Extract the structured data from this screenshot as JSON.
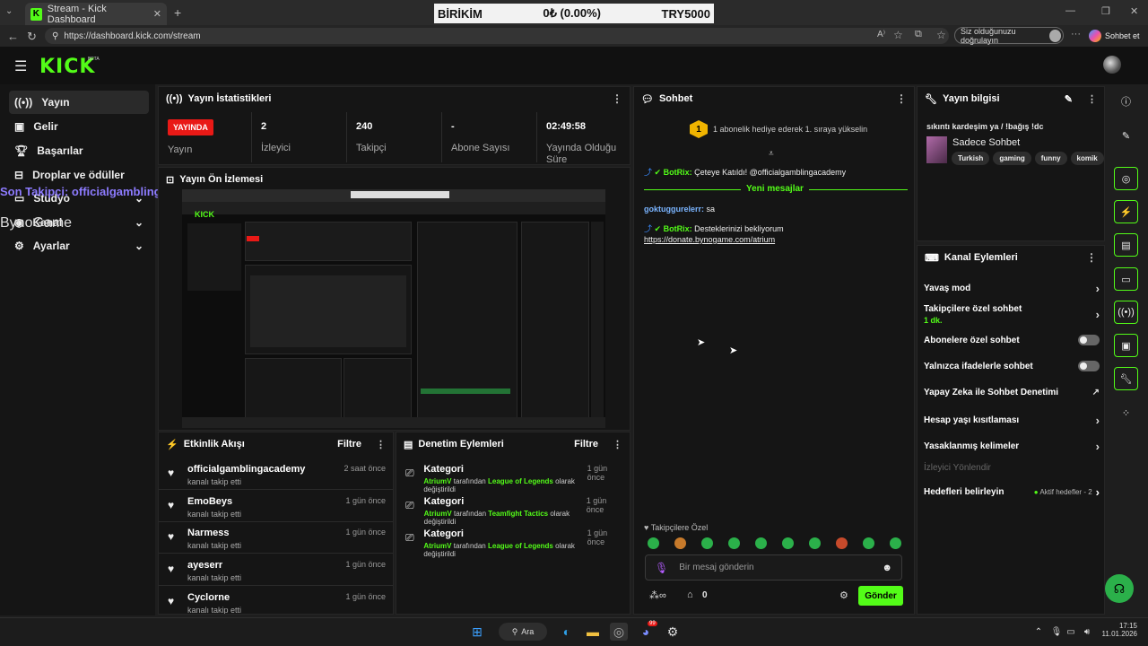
{
  "browser": {
    "tab_title": "Stream - Kick Dashboard",
    "url": "https://dashboard.kick.com/stream",
    "verify_label": "Siz olduğunuzu doğrulayın",
    "sohbet_et": "Sohbet et",
    "ticker": {
      "name": "BİRİKİM",
      "value": "0₺ (0.00%)",
      "total": "TRY5000"
    }
  },
  "app": {
    "logo": "KICK",
    "beta": "BETA"
  },
  "sidebar": {
    "items": [
      {
        "label": "Yayın",
        "icon": "broadcast-icon"
      },
      {
        "label": "Gelir",
        "icon": "money-icon"
      },
      {
        "label": "Başarılar",
        "icon": "trophy-icon"
      },
      {
        "label": "Droplar ve ödüller",
        "icon": "gift-icon"
      },
      {
        "label": "Stüdyo",
        "icon": "studio-icon"
      },
      {
        "label": "Kanal",
        "icon": "channel-icon"
      },
      {
        "label": "Ayarlar",
        "icon": "gear-icon"
      }
    ],
    "overlay_follower": "Son Takipçi: officialgamblingacademy",
    "overlay_logo": "BynoGame"
  },
  "stats": {
    "title": "Yayın İstatistikleri",
    "live_badge": "YAYINDA",
    "live_label": "Yayın",
    "viewers": "2",
    "viewers_label": "İzleyici",
    "followers": "240",
    "followers_label": "Takipçi",
    "subs": "-",
    "subs_label": "Abone Sayısı",
    "uptime": "02:49:58",
    "uptime_label": "Yayında Olduğu Süre"
  },
  "preview": {
    "title": "Yayın Ön İzlemesi"
  },
  "activity": {
    "title": "Etkinlik Akışı",
    "filter": "Filtre",
    "items": [
      {
        "name": "officialgamblingacademy",
        "sub": "kanalı takip etti",
        "time": "2 saat önce"
      },
      {
        "name": "EmoBeys",
        "sub": "kanalı takip etti",
        "time": "1 gün önce"
      },
      {
        "name": "Narmess",
        "sub": "kanalı takip etti",
        "time": "1 gün önce"
      },
      {
        "name": "ayeserr",
        "sub": "kanalı takip etti",
        "time": "1 gün önce"
      },
      {
        "name": "Cyclorne",
        "sub": "kanalı takip etti",
        "time": "1 gün önce"
      }
    ]
  },
  "moderation": {
    "title": "Denetim Eylemleri",
    "filter": "Filtre",
    "items": [
      {
        "title": "Kategori",
        "user": "AtriumV",
        "mid": "tarafından",
        "game": "League of Legends",
        "end": "olarak değiştirildi",
        "time": "1 gün önce"
      },
      {
        "title": "Kategori",
        "user": "AtriumV",
        "mid": "tarafından",
        "game": "Teamfight Tactics",
        "end": "olarak değiştirildi",
        "time": "1 gün önce"
      },
      {
        "title": "Kategori",
        "user": "AtriumV",
        "mid": "tarafından",
        "game": "League of Legends",
        "end": "olarak değiştirildi",
        "time": "1 gün önce"
      }
    ]
  },
  "chat": {
    "title": "Sohbet",
    "gift_badge": "1",
    "gift_text": "1 abonelik hediye ederek 1. sıraya yükselin",
    "msg1_user": "BotRix:",
    "msg1_text": "Çeteye Katıldı! @officialgamblingacademy",
    "new_messages": "Yeni mesajlar",
    "msg2_user": "goktuggurelerr:",
    "msg2_text": "sa",
    "msg3_user": "BotRix:",
    "msg3_text": "Desteklerinizi bekliyorum",
    "msg3_link": "https://donate.bynogame.com/atrium",
    "followers_only": "Takipçilere Özel",
    "input_placeholder": "Bir mesaj gönderin",
    "points": "0",
    "send": "Gönder"
  },
  "stream_info": {
    "title": "Yayın bilgisi",
    "stream_title": "sıkıntı kardeşim ya / !bağış !dc",
    "category": "Sadece Sohbet",
    "tags": [
      "Turkish",
      "gaming",
      "funny",
      "komik"
    ]
  },
  "channel_actions": {
    "title": "Kanal Eylemleri",
    "slow_mode": "Yavaş mod",
    "followers_chat": "Takipçilere özel sohbet",
    "followers_chat_value": "1 dk.",
    "subs_chat": "Abonelere özel sohbet",
    "emote_chat": "Yalnızca ifadelerle sohbet",
    "ai_mod": "Yapay Zeka ile Sohbet Denetimi",
    "age_limit": "Hesap yaşı kısıtlaması",
    "banned_words": "Yasaklanmış kelimeler",
    "redirect": "İzleyici Yönlendir",
    "goals": "Hedefleri belirleyin",
    "goals_value": "Aktif hedefler - 2"
  },
  "taskbar": {
    "search": "Ara",
    "time": "17:15",
    "date": "11.01.2026",
    "discord_badge": "99"
  },
  "colors": {
    "accent": "#53fc18",
    "live": "#e91916",
    "bg": "#151515"
  }
}
